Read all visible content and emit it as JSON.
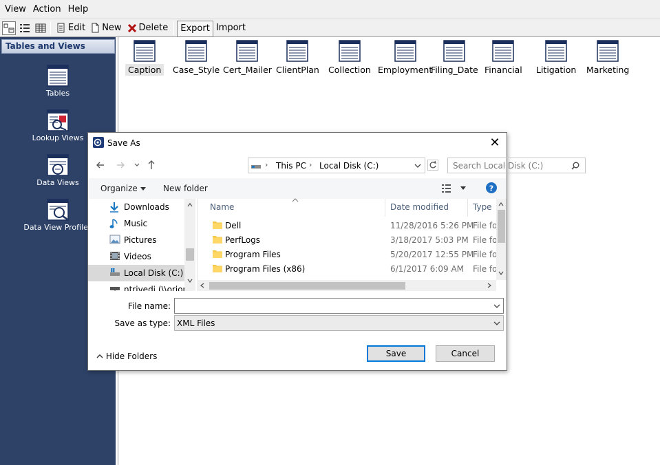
{
  "menu": {
    "view": "View",
    "action": "Action",
    "help": "Help"
  },
  "toolbar": {
    "edit": "Edit",
    "new": "New",
    "delete": "Delete",
    "export": "Export",
    "import": "Import"
  },
  "sidebar": {
    "header": "Tables and Views",
    "items": [
      {
        "label": "Tables",
        "icon": "table-icon"
      },
      {
        "label": "Lookup Views",
        "icon": "lookup-view-icon"
      },
      {
        "label": "Data Views",
        "icon": "data-view-icon"
      },
      {
        "label": "Data View Profiles",
        "icon": "data-view-profile-icon"
      }
    ]
  },
  "tables": [
    "Caption",
    "Case_Style",
    "Cert_Mailer",
    "ClientPlan",
    "Collection",
    "Employment",
    "Filing_Date",
    "Financial",
    "Litigation",
    "Marketing"
  ],
  "dialog": {
    "title": "Save As",
    "path": {
      "root": "This PC",
      "current": "Local Disk (C:)"
    },
    "search_placeholder": "Search Local Disk (C:)",
    "organize": "Organize",
    "new_folder": "New folder",
    "nav": [
      "Downloads",
      "Music",
      "Pictures",
      "Videos",
      "Local Disk (C:)",
      "ntrivedi (\\\\orion"
    ],
    "columns": {
      "name": "Name",
      "date": "Date modified",
      "type": "Type"
    },
    "files": [
      {
        "name": "Dell",
        "date": "11/28/2016 5:26 PM",
        "type": "File folder"
      },
      {
        "name": "PerfLogs",
        "date": "3/18/2017 5:03 PM",
        "type": "File folder"
      },
      {
        "name": "Program Files",
        "date": "5/20/2017 12:55 PM",
        "type": "File folder"
      },
      {
        "name": "Program Files (x86)",
        "date": "6/1/2017 6:09 AM",
        "type": "File folder"
      }
    ],
    "file_name_label": "File name:",
    "file_name_value": "",
    "save_type_label": "Save as type:",
    "save_type_value": "XML Files",
    "hide_folders": "Hide Folders",
    "save": "Save",
    "cancel": "Cancel"
  },
  "colors": {
    "sidebar": "#2e4268",
    "accent": "#0078d7",
    "help": "#1f6fc4"
  }
}
